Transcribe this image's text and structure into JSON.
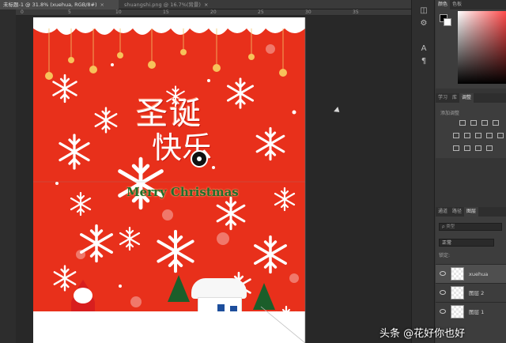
{
  "tabs": [
    {
      "label": "未标题-1 @ 31.8% (xuehua, RGB/8#)",
      "close": "×"
    },
    {
      "label": "shuangshi.png @ 16.7%(背景)",
      "close": "×"
    }
  ],
  "ruler_ticks": [
    "0",
    "5",
    "10",
    "15",
    "20",
    "25",
    "30",
    "35"
  ],
  "artwork": {
    "title_line1": "圣诞",
    "title_line2": "快乐",
    "subtitle": "Merry Christmas",
    "colors": {
      "background": "#e8301b",
      "title_green": "#1e6f2c",
      "house_blue": "#1d4e9c"
    }
  },
  "toolstrip": {
    "icons": [
      "history-icon",
      "adjust-icon",
      "character-icon",
      "paragraph-icon"
    ]
  },
  "color_panel": {
    "tabs": [
      "颜色",
      "色板"
    ]
  },
  "adjust_panel": {
    "tabs": [
      "学习",
      "库",
      "调整"
    ],
    "hint": "添加调整"
  },
  "layers_panel": {
    "tabs": [
      "通道",
      "路径",
      "图层"
    ],
    "search_placeholder": "ρ 类型",
    "blend_mode": "正常",
    "lock_label": "锁定:",
    "layers": [
      {
        "name": "xuehua",
        "selected": true
      },
      {
        "name": "图层 2",
        "selected": false
      },
      {
        "name": "图层 1",
        "selected": false
      }
    ]
  },
  "watermark": "头条 @花好你也好"
}
